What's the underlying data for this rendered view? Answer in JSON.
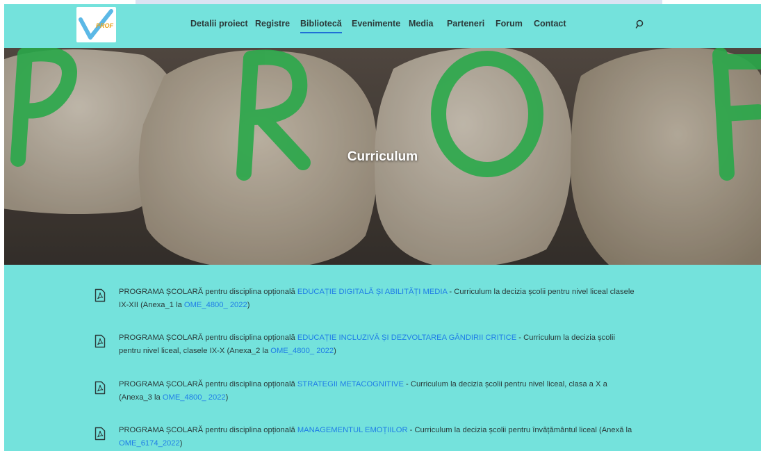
{
  "header": {
    "logo_text": "PROF",
    "nav": [
      "Detalii proiect",
      "Registre",
      "Bibliotecă",
      "Evenimente",
      "Media",
      "Parteneri",
      "Forum",
      "Contact"
    ],
    "active_nav": "Bibliotecă",
    "search_icon": "search-icon"
  },
  "hero": {
    "title": "Curriculum",
    "letters": [
      "P",
      "R",
      "O",
      "F"
    ]
  },
  "documents": [
    {
      "prefix": "PROGRAMA ȘCOLARĂ pentru disciplina opțională ",
      "subject": "EDUCAȚIE DIGITALĂ ȘI ABILITĂȚI MEDIA",
      "middle": " - Curriculum la decizia școlii pentru nivel liceal clasele IX-XII (Anexa_1 la ",
      "order": "OME_4800_ 2022",
      "suffix": ")"
    },
    {
      "prefix": "PROGRAMA ȘCOLARĂ pentru disciplina opțională ",
      "subject": "EDUCAȚIE INCLUZIVĂ ȘI DEZVOLTAREA GÂNDIRII CRITICE",
      "middle": " - Curriculum la decizia școlii pentru nivel liceal, clasele IX-X (Anexa_2 la ",
      "order": "OME_4800_ 2022",
      "suffix": ")"
    },
    {
      "prefix": "PROGRAMA ȘCOLARĂ pentru disciplina opțională ",
      "subject": "STRATEGII METACOGNITIVE",
      "middle": " - Curriculum la decizia școlii pentru nivel liceal, clasa a X a (Anexa_3 la ",
      "order": "OME_4800_ 2022",
      "suffix": ")"
    },
    {
      "prefix": "PROGRAMA ȘCOLARĂ pentru disciplina opțională ",
      "subject": "MANAGEMENTUL EMOȚIILOR",
      "middle": " - Curriculum la decizia școlii pentru învățământul liceal (Anexă la ",
      "order": "OME_6174_2022",
      "suffix": ")"
    }
  ],
  "colors": {
    "background": "#74e2dc",
    "link": "#1f7de6",
    "active_underline": "#1f6fd6",
    "paint_green": "#2aa84a"
  }
}
